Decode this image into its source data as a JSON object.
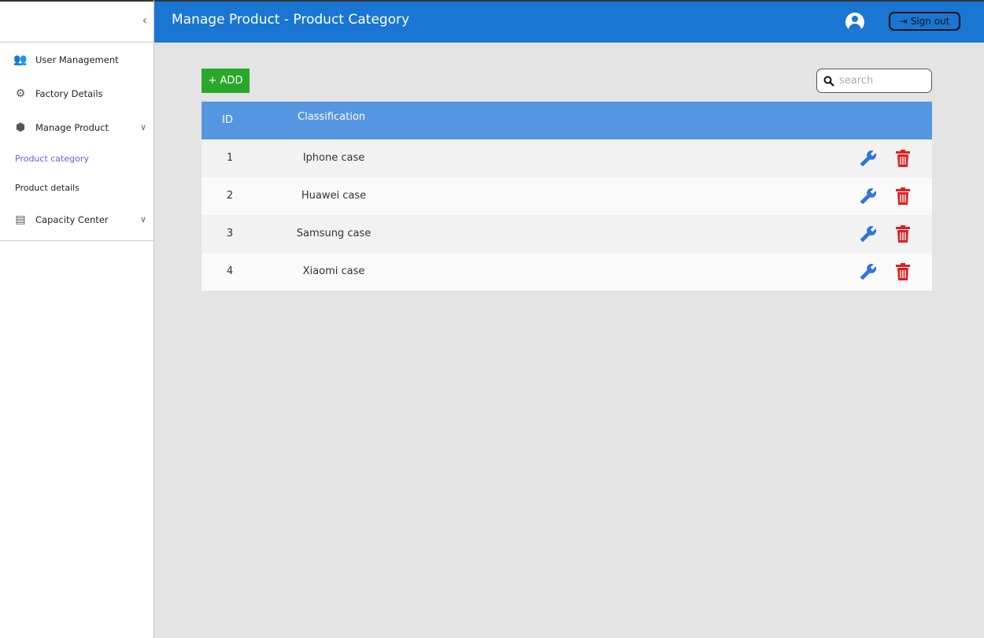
{
  "header": {
    "title": "Manage Product - Product Category",
    "sign_out": "Sign out"
  },
  "sidebar": {
    "items": [
      {
        "label": "User Management"
      },
      {
        "label": "Factory Details"
      },
      {
        "label": "Manage Product"
      },
      {
        "label": "Product category"
      },
      {
        "label": "Product details"
      },
      {
        "label": "Capacity Center"
      }
    ]
  },
  "toolbar": {
    "add_label": "+ ADD",
    "search_placeholder": "search"
  },
  "table": {
    "headers": [
      "ID",
      "Classification"
    ],
    "rows": [
      {
        "id": "1",
        "name": "Iphone case"
      },
      {
        "id": "2",
        "name": "Huawei case"
      },
      {
        "id": "3",
        "name": "Samsung case"
      },
      {
        "id": "4",
        "name": "Xiaomi case"
      }
    ]
  },
  "colors": {
    "header": "#1976d2",
    "table_header": "#5596e0",
    "add": "#28a828",
    "edit": "#2f74e0",
    "delete": "#e02020",
    "active": "#6b5ce7"
  }
}
